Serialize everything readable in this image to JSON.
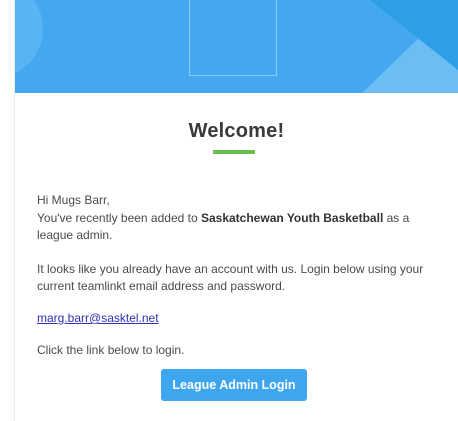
{
  "header": {
    "title": "Welcome!"
  },
  "message": {
    "greeting": "Hi Mugs Barr,",
    "added_prefix": "You've recently been added to ",
    "organization": "Saskatchewan Youth Basketball",
    "added_suffix": " as a league admin.",
    "account_text": "It looks like you already have an account with us. Login below using your current teamlinkt email address and password.",
    "email": "marg.barr@sasktel.net",
    "click_text": "Click the link below to login."
  },
  "button": {
    "login_label": "League Admin Login"
  },
  "colors": {
    "hero_blue": "#44a8f0",
    "accent_green": "#6abf4b",
    "button_blue": "#3ea6ef",
    "link": "#2f2fb8"
  }
}
